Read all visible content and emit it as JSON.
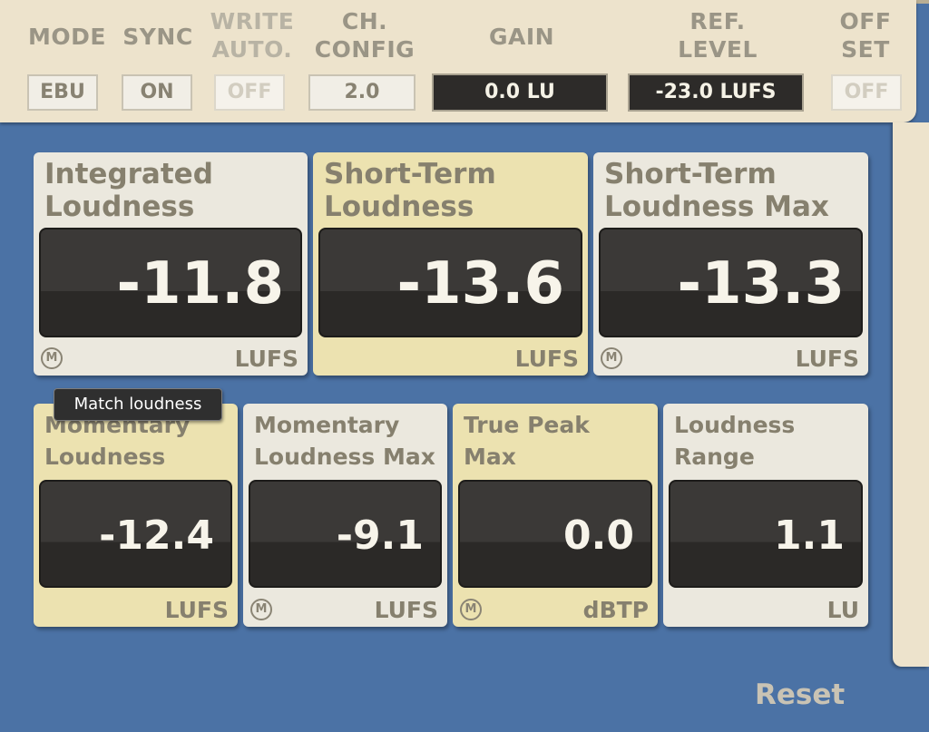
{
  "header": {
    "mode": {
      "label": "MODE",
      "value": "EBU"
    },
    "sync": {
      "label": "SYNC",
      "value": "ON"
    },
    "write_auto": {
      "label": "WRITE\nAUTO.",
      "value": "OFF"
    },
    "ch_config": {
      "label": "CH.\nCONFIG",
      "value": "2.0"
    },
    "gain": {
      "label": "GAIN",
      "value": "0.0 LU"
    },
    "ref_level": {
      "label": "REF.\nLEVEL",
      "value": "-23.0 LUFS"
    },
    "offset": {
      "label": "OFF\nSET",
      "value": "OFF"
    }
  },
  "meters": {
    "integrated": {
      "title": "Integrated\nLoudness",
      "value": "-11.8",
      "unit": "LUFS",
      "icon": "M"
    },
    "short_term": {
      "title": "Short-Term\nLoudness",
      "value": "-13.6",
      "unit": "LUFS"
    },
    "short_term_max": {
      "title": "Short-Term\nLoudness Max",
      "value": "-13.3",
      "unit": "LUFS",
      "icon": "M"
    },
    "momentary": {
      "title": "Momentary\nLoudness",
      "value": "-12.4",
      "unit": "LUFS"
    },
    "momentary_max": {
      "title": "Momentary\nLoudness Max",
      "value": "-9.1",
      "unit": "LUFS",
      "icon": "M"
    },
    "true_peak": {
      "title": "True Peak\nMax",
      "value": "0.0",
      "unit": "dBTP",
      "icon": "M"
    },
    "loudness_range": {
      "title": "Loudness\nRange",
      "value": "1.1",
      "unit": "LU"
    }
  },
  "tooltip": "Match loudness",
  "reset_label": "Reset",
  "colors": {
    "background": "#4b72a5",
    "panel": "#ede3cc",
    "card_light": "#ebe8de",
    "card_yellow": "#ece2b0",
    "display": "#2d2b29"
  }
}
